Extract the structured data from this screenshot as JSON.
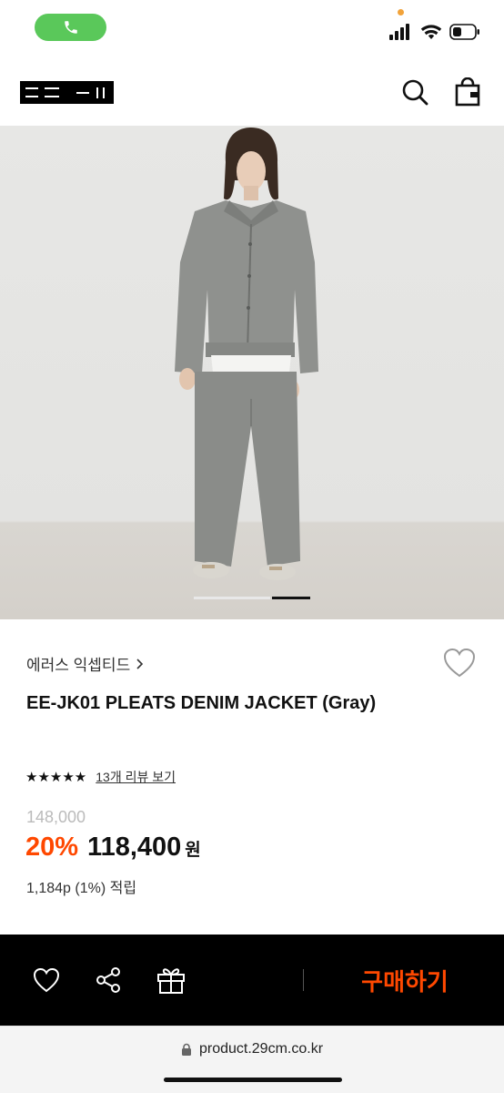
{
  "status_bar": {
    "call_icon": "phone-icon",
    "signal_icon": "cellular-signal-icon",
    "wifi_icon": "wifi-icon",
    "battery_icon": "battery-icon",
    "accent": "#5ac85a"
  },
  "header": {
    "logo_text": "29CM",
    "search_icon": "search-icon",
    "bag_icon": "shopping-bag-icon"
  },
  "hero": {
    "image_alt": "model wearing gray denim jacket and pants",
    "carousel_active_index": 1,
    "carousel_count": 2
  },
  "product": {
    "brand": "에러스 익셉티드",
    "title": "EE-JK01 PLEATS DENIM JACKET (Gray)",
    "rating_stars": "★★★★★",
    "rating_value": 5,
    "review_link": "13개 리뷰 보기",
    "original_price": "148,000",
    "discount": "20%",
    "price": "118,400",
    "currency": "원",
    "points": "1,184p (1%) 적립",
    "accent": "#ff4800"
  },
  "action_bar": {
    "like_icon": "heart-icon",
    "share_icon": "share-icon",
    "gift_icon": "gift-icon",
    "buy_label": "구매하기"
  },
  "browser": {
    "url": "product.29cm.co.kr",
    "lock_icon": "lock-icon"
  }
}
